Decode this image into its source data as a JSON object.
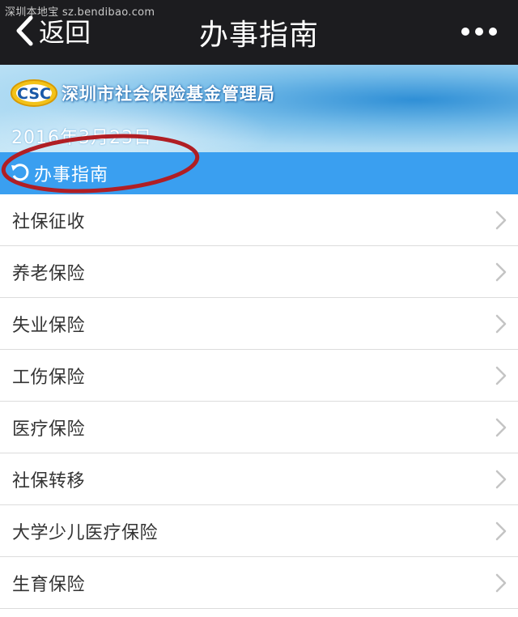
{
  "watermark": "深圳本地宝  sz.bendibao.com",
  "navbar": {
    "back_label": "返回",
    "title": "办事指南",
    "more_icon": "ellipsis-icon"
  },
  "banner": {
    "logo_text": "CSC",
    "org_name": "深圳市社会保险基金管理局",
    "date": "2016年3月23日"
  },
  "section": {
    "icon": "refresh-icon",
    "title": "办事指南"
  },
  "colors": {
    "navbar_bg": "#1c1c1f",
    "section_bg": "#3a9ff0",
    "annotation": "#b01e24",
    "divider": "#dcdcdc"
  },
  "items": [
    {
      "label": "社保征收"
    },
    {
      "label": "养老保险"
    },
    {
      "label": "失业保险"
    },
    {
      "label": "工伤保险"
    },
    {
      "label": "医疗保险"
    },
    {
      "label": "社保转移"
    },
    {
      "label": "大学少儿医疗保险"
    },
    {
      "label": "生育保险"
    }
  ]
}
